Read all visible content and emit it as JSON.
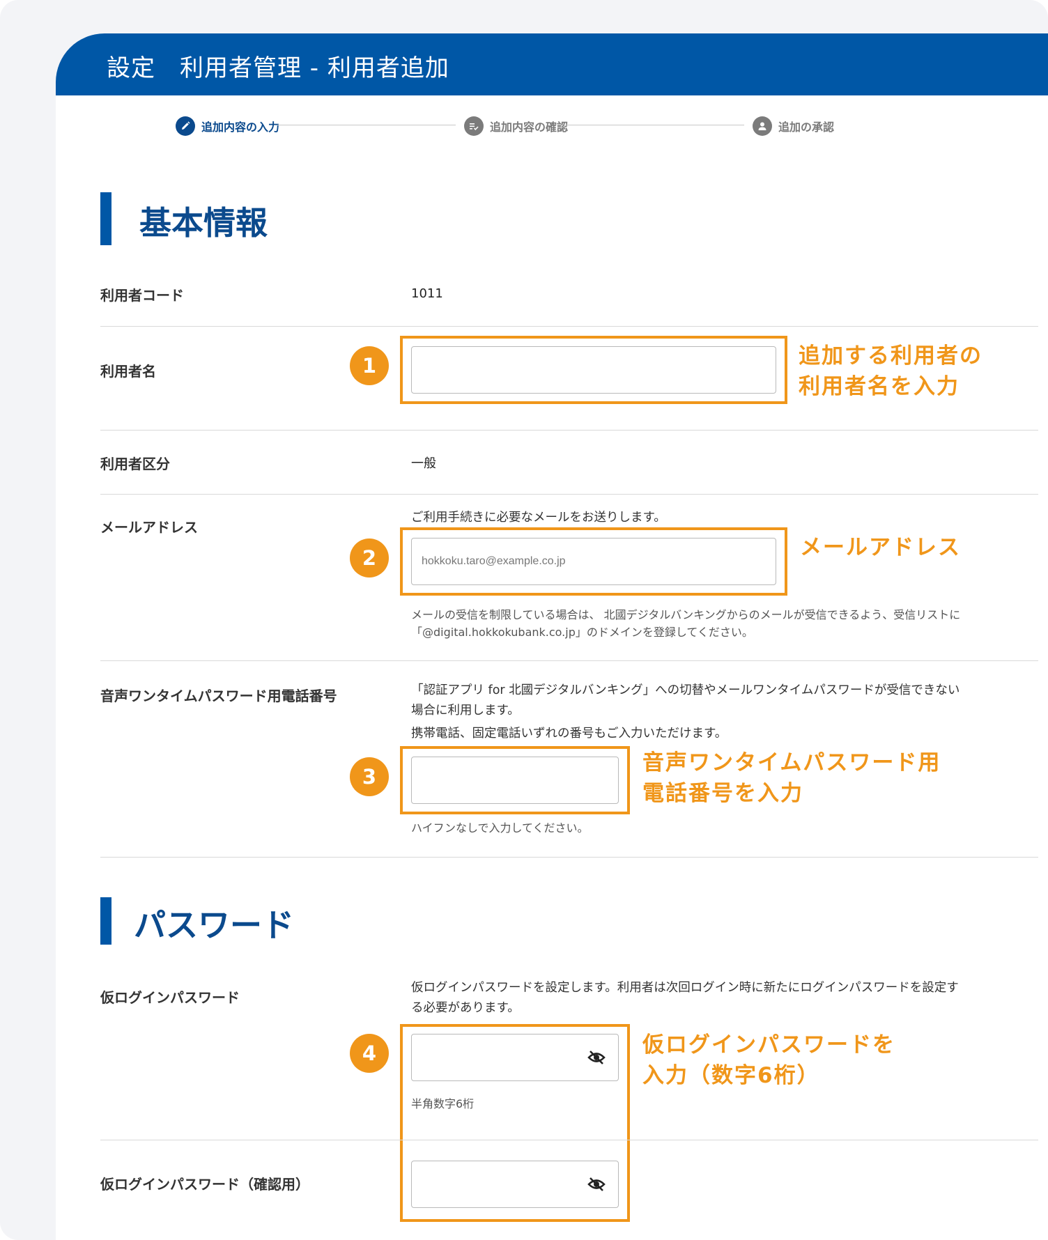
{
  "header": {
    "title": "設定　利用者管理 - 利用者追加"
  },
  "steps": [
    {
      "label": "追加内容の入力",
      "icon": "pencil-icon",
      "state": "active"
    },
    {
      "label": "追加内容の確認",
      "icon": "list-check-icon",
      "state": "inactive"
    },
    {
      "label": "追加の承認",
      "icon": "user-icon",
      "state": "inactive"
    }
  ],
  "sections": {
    "basic": {
      "title": "基本情報"
    },
    "password": {
      "title": "パスワード"
    }
  },
  "fields": {
    "user_code": {
      "label": "利用者コード",
      "value": "1011"
    },
    "user_name": {
      "label": "利用者名",
      "value": ""
    },
    "user_type": {
      "label": "利用者区分",
      "value": "一般"
    },
    "email": {
      "label": "メールアドレス",
      "help": "ご利用手続きに必要なメールをお送りします。",
      "placeholder": "hokkoku.taro@example.co.jp",
      "note_line1": "メールの受信を制限している場合は、 北國デジタルバンキングからのメールが受信できるよう、受信リストに",
      "note_line2": "「@digital.hokkokubank.co.jp」のドメインを登録してください。"
    },
    "phone": {
      "label": "音声ワンタイムパスワード用電話番号",
      "help_line1": "「認証アプリ for 北國デジタルバンキング」への切替やメールワンタイムパスワードが受信できない",
      "help_line2": "場合に利用します。",
      "help_line3": "携帯電話、固定電話いずれの番号もご入力いただけます。",
      "note": "ハイフンなしで入力してください。",
      "value": ""
    },
    "temp_password": {
      "label": "仮ログインパスワード",
      "help_line1": "仮ログインパスワードを設定します。利用者は次回ログイン時に新たにログインパスワードを設定す",
      "help_line2": "る必要があります。",
      "note": "半角数字6桁",
      "value": ""
    },
    "temp_password_confirm": {
      "label": "仮ログインパスワード（確認用）",
      "value": ""
    }
  },
  "callouts": [
    {
      "number": "1",
      "line1": "追加する利用者の",
      "line2": "利用者名を入力"
    },
    {
      "number": "2",
      "line1": "メールアドレス",
      "line2": ""
    },
    {
      "number": "3",
      "line1": "音声ワンタイムパスワード用",
      "line2": "電話番号を入力"
    },
    {
      "number": "4",
      "line1": "仮ログインパスワードを",
      "line2": "入力（数字6桁）"
    }
  ],
  "colors": {
    "header_blue": "#0057a6",
    "step_active": "#0b4a8d",
    "step_inactive": "#7b7b7b",
    "callout_orange": "#f0961a"
  },
  "icons": {
    "password_toggle": "eye-slash-icon"
  }
}
